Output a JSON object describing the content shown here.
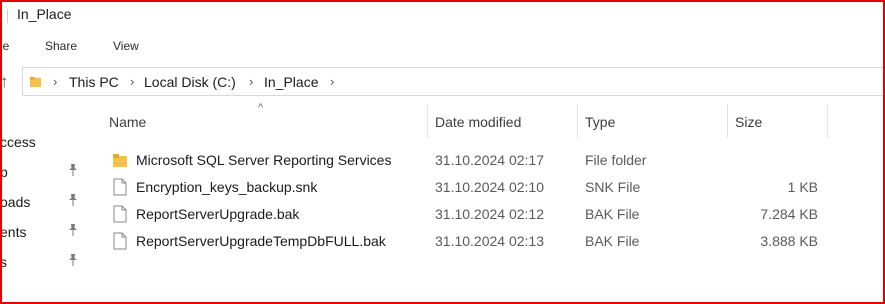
{
  "window": {
    "title": "In_Place"
  },
  "ribbon": {
    "tabs": [
      "le",
      "Share",
      "View"
    ]
  },
  "address": {
    "crumbs": [
      "This PC",
      "Local Disk (C:)",
      "In_Place"
    ]
  },
  "nav_pane": {
    "items": [
      {
        "label": "ccess",
        "pinned": false
      },
      {
        "label": "p",
        "pinned": true
      },
      {
        "label": "oads",
        "pinned": true
      },
      {
        "label": "ents",
        "pinned": true
      },
      {
        "label": "s",
        "pinned": true
      }
    ]
  },
  "columns": {
    "name": "Name",
    "date": "Date modified",
    "type": "Type",
    "size": "Size"
  },
  "files": [
    {
      "name": "Microsoft SQL Server Reporting Services",
      "date": "31.10.2024 02:17",
      "type": "File folder",
      "size": "",
      "icon": "folder-icon"
    },
    {
      "name": "Encryption_keys_backup.snk",
      "date": "31.10.2024 02:10",
      "type": "SNK File",
      "size": "1 KB",
      "icon": "file-icon"
    },
    {
      "name": "ReportServerUpgrade.bak",
      "date": "31.10.2024 02:12",
      "type": "BAK File",
      "size": "7.284 KB",
      "icon": "file-icon"
    },
    {
      "name": "ReportServerUpgradeTempDbFULL.bak",
      "date": "31.10.2024 02:13",
      "type": "BAK File",
      "size": "3.888 KB",
      "icon": "file-icon"
    }
  ],
  "colors": {
    "highlight_border": "#e60000",
    "folder": "#f3c24d"
  }
}
